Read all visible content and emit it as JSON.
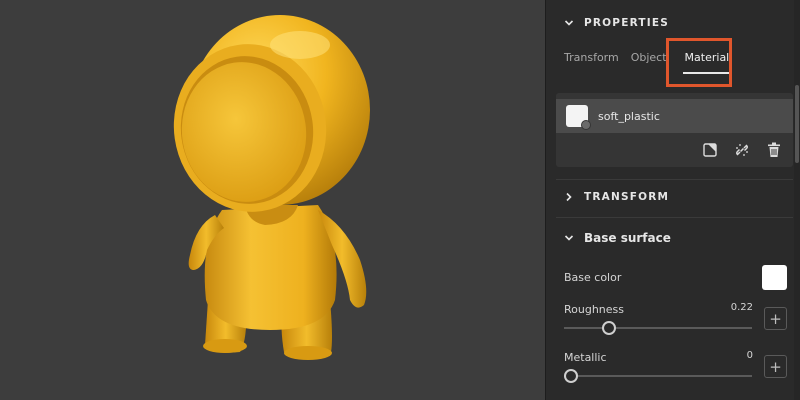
{
  "viewport": {
    "background": "#3d3d3d",
    "model_color": "#f1b51f"
  },
  "panel": {
    "properties_title": "PROPERTIES",
    "tabs": [
      {
        "label": "Transform",
        "active": false
      },
      {
        "label": "Object",
        "active": false
      },
      {
        "label": "Material",
        "active": true
      }
    ],
    "highlight_color": "#e0562c",
    "material": {
      "name": "soft_plastic",
      "icons": [
        "new-material-icon",
        "unlink-icon",
        "trash-icon"
      ]
    },
    "transform_title": "TRANSFORM",
    "base_surface": {
      "title": "Base surface",
      "base_color_label": "Base color",
      "base_color": "#ffffff",
      "roughness_label": "Roughness",
      "roughness_value": "0.22",
      "metallic_label": "Metallic",
      "metallic_value": "0"
    }
  }
}
